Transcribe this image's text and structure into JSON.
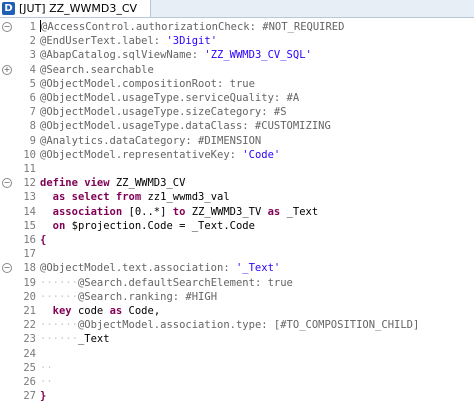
{
  "editor": {
    "tab_icon_letter": "D",
    "tab_title": "[JUT] ZZ_WWMD3_CV",
    "fold_markers": {
      "1": "⊖",
      "4": "⊕",
      "12": "⊖",
      "18": "⊖"
    },
    "lines": [
      {
        "n": "1",
        "segs": [
          {
            "t": "@AccessControl.authorizationCheck: ",
            "c": "ann"
          },
          {
            "t": "#NOT_REQUIRED",
            "c": "ann"
          }
        ]
      },
      {
        "n": "2",
        "segs": [
          {
            "t": "@EndUserText.label: ",
            "c": "ann"
          },
          {
            "t": "'3Digit'",
            "c": "str"
          }
        ]
      },
      {
        "n": "3",
        "segs": [
          {
            "t": "@AbapCatalog.sqlViewName: ",
            "c": "ann"
          },
          {
            "t": "'ZZ_WWMD3_CV_SQL'",
            "c": "str"
          }
        ]
      },
      {
        "n": "4",
        "segs": [
          {
            "t": "@Search.searchable",
            "c": "ann"
          }
        ]
      },
      {
        "n": "5",
        "segs": [
          {
            "t": "@ObjectModel.compositionRoot: true",
            "c": "ann"
          }
        ]
      },
      {
        "n": "6",
        "segs": [
          {
            "t": "@ObjectModel.usageType.serviceQuality: #A",
            "c": "ann"
          }
        ]
      },
      {
        "n": "7",
        "segs": [
          {
            "t": "@ObjectModel.usageType.sizeCategory: #S",
            "c": "ann"
          }
        ]
      },
      {
        "n": "8",
        "segs": [
          {
            "t": "@ObjectModel.usageType.dataClass: #CUSTOMIZING",
            "c": "ann"
          }
        ]
      },
      {
        "n": "9",
        "segs": [
          {
            "t": "@Analytics.dataCategory: #DIMENSION",
            "c": "ann"
          }
        ]
      },
      {
        "n": "10",
        "segs": [
          {
            "t": "@ObjectModel.representativeKey: ",
            "c": "ann"
          },
          {
            "t": "'Code'",
            "c": "str"
          }
        ]
      },
      {
        "n": "11",
        "segs": []
      },
      {
        "n": "12",
        "segs": [
          {
            "t": "define view ",
            "c": "kw"
          },
          {
            "t": "ZZ_WWMD3_CV",
            "c": "plain"
          }
        ]
      },
      {
        "n": "13",
        "segs": [
          {
            "t": "  ",
            "c": "plain"
          },
          {
            "t": "as select from ",
            "c": "kw"
          },
          {
            "t": "zz1_wwmd3_val",
            "c": "plain"
          }
        ]
      },
      {
        "n": "14",
        "segs": [
          {
            "t": "  ",
            "c": "plain"
          },
          {
            "t": "association ",
            "c": "kw"
          },
          {
            "t": "[0..*] ",
            "c": "plain"
          },
          {
            "t": "to ",
            "c": "kw"
          },
          {
            "t": "ZZ_WWMD3_TV ",
            "c": "plain"
          },
          {
            "t": "as ",
            "c": "kw"
          },
          {
            "t": "_Text",
            "c": "plain"
          }
        ]
      },
      {
        "n": "15",
        "segs": [
          {
            "t": "  ",
            "c": "plain"
          },
          {
            "t": "on ",
            "c": "kw"
          },
          {
            "t": "$projection.Code = _Text.Code",
            "c": "plain"
          }
        ]
      },
      {
        "n": "16",
        "segs": [
          {
            "t": "{",
            "c": "kw"
          }
        ]
      },
      {
        "n": "17",
        "segs": []
      },
      {
        "n": "18",
        "segs": [
          {
            "t": "@ObjectModel.text.association: ",
            "c": "ann"
          },
          {
            "t": "'_Text'",
            "c": "str"
          }
        ]
      },
      {
        "n": "19",
        "segs": [
          {
            "t": "······",
            "c": "ws"
          },
          {
            "t": "@Search.defaultSearchElement: true",
            "c": "ann"
          }
        ]
      },
      {
        "n": "20",
        "segs": [
          {
            "t": "······",
            "c": "ws"
          },
          {
            "t": "@Search.ranking: #HIGH",
            "c": "ann"
          }
        ]
      },
      {
        "n": "21",
        "segs": [
          {
            "t": "  ",
            "c": "plain"
          },
          {
            "t": "key ",
            "c": "kw"
          },
          {
            "t": "code ",
            "c": "plain"
          },
          {
            "t": "as ",
            "c": "kw"
          },
          {
            "t": "Code,",
            "c": "plain"
          }
        ]
      },
      {
        "n": "22",
        "segs": [
          {
            "t": "······",
            "c": "ws"
          },
          {
            "t": "@ObjectModel.association.type: [#TO_COMPOSITION_CHILD]",
            "c": "ann"
          }
        ]
      },
      {
        "n": "23",
        "segs": [
          {
            "t": "······",
            "c": "ws"
          },
          {
            "t": "_Text",
            "c": "plain"
          }
        ]
      },
      {
        "n": "24",
        "segs": []
      },
      {
        "n": "25",
        "segs": [
          {
            "t": "··",
            "c": "ws"
          }
        ]
      },
      {
        "n": "26",
        "segs": [
          {
            "t": "··",
            "c": "ws"
          }
        ]
      },
      {
        "n": "27",
        "segs": [
          {
            "t": "}",
            "c": "kw"
          }
        ]
      }
    ]
  }
}
